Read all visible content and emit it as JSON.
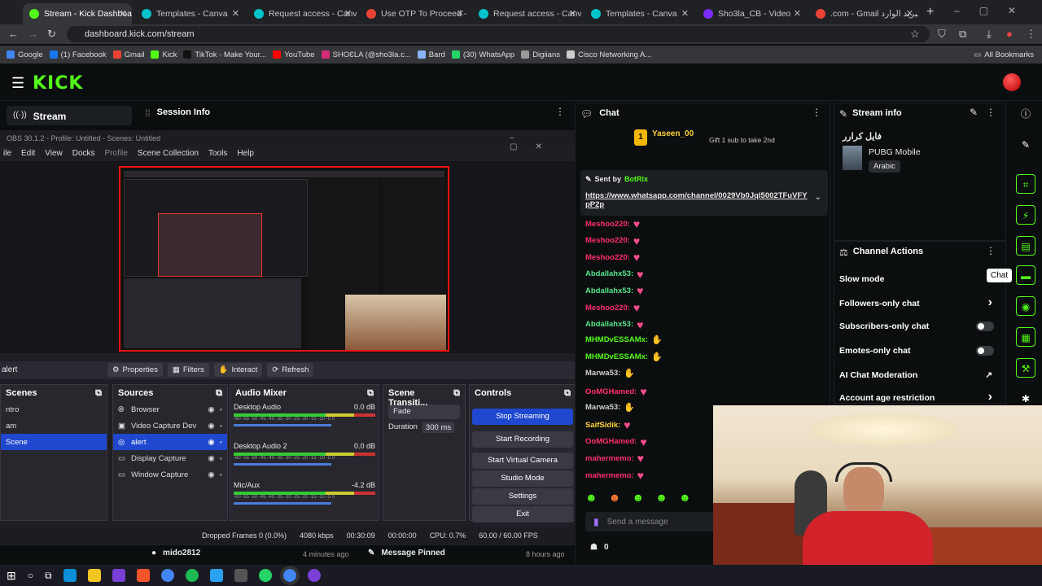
{
  "browser": {
    "tabs": [
      {
        "label": "Stream - Kick Dashboard",
        "active": true,
        "color": "#53fc18"
      },
      {
        "label": "Templates - Canva",
        "color": "#00c4cc"
      },
      {
        "label": "Request access - Canva",
        "color": "#00c4cc"
      },
      {
        "label": "Use OTP To Proceed - you",
        "color": "#ea4335"
      },
      {
        "label": "Request access - Canva",
        "color": "#00c4cc"
      },
      {
        "label": "Templates - Canva",
        "color": "#00c4cc"
      },
      {
        "label": "Sho3la_CB - Video",
        "color": "#7b2cff"
      },
      {
        "label": ".com - Gmail البريد الوارد",
        "color": "#ea4335"
      }
    ],
    "url": "dashboard.kick.com/stream",
    "bookmarks": [
      "Google",
      "(1) Facebook",
      "Gmail",
      "Kick",
      "TikTok - Make Your...",
      "YouTube",
      "SHOƐLA (@sho3la.c...",
      "Bard",
      "(30) WhatsApp",
      "Digiians",
      "Cisco Networking A..."
    ],
    "all_bookmarks": "All Bookmarks"
  },
  "kick": {
    "logo": "KICK",
    "sidebar_stream": "Stream",
    "session_info": "Session Info",
    "chat_title": "Chat",
    "stream_info_title": "Stream info",
    "gifter_name": "Yaseen_00",
    "gifter_count": "1",
    "gift_text": "Gift 1 sub to take 2nd",
    "pinned": {
      "sent_by": "Sent by",
      "sender": "BotRix",
      "link": "https://www.whatsapp.com/channel/0029Vb0Jql5002TFuVFYpP2p"
    },
    "messages": [
      {
        "user": "Meshoo220:",
        "color": "#ff2f6b",
        "emote": "heart"
      },
      {
        "user": "Meshoo220:",
        "color": "#ff2f6b",
        "emote": "heart"
      },
      {
        "user": "Meshoo220:",
        "color": "#ff2f6b",
        "emote": "heart"
      },
      {
        "user": "Abdallahx53:",
        "color": "#57e389",
        "emote": "heart"
      },
      {
        "user": "Abdallahx53:",
        "color": "#57e389",
        "emote": "heart"
      },
      {
        "user": "Meshoo220:",
        "color": "#ff2f6b",
        "emote": "heart"
      },
      {
        "user": "Abdallahx53:",
        "color": "#57e389",
        "emote": "heart"
      },
      {
        "user": "MHMDvESSAMx:",
        "color": "#53fc18",
        "emote": "hands"
      },
      {
        "user": "MHMDvESSAMx:",
        "color": "#53fc18",
        "emote": "hands"
      },
      {
        "user": "Marwa53:",
        "color": "#cfcfcf",
        "emote": "hands"
      },
      {
        "user": "OoMGHamed:",
        "color": "#ff2f6b",
        "emote": "heart"
      },
      {
        "user": "Marwa53:",
        "color": "#cfcfcf",
        "emote": "hands"
      },
      {
        "user": "SaifSidik:",
        "color": "#ffd33d",
        "emote": "heart"
      },
      {
        "user": "OoMGHamed:",
        "color": "#ff2f6b",
        "emote": "heart"
      },
      {
        "user": "mahermemo:",
        "color": "#ff2f6b",
        "emote": "heart"
      },
      {
        "user": "mahermemo:",
        "color": "#ff2f6b",
        "emote": "heart"
      }
    ],
    "send_placeholder": "Send a message",
    "chat_count": "0",
    "stream_title": "فايل كرارر",
    "game": "PUBG Mobile",
    "language": "Arabic",
    "channel_actions": "Channel Actions",
    "actions": [
      "Slow mode",
      "Followers-only chat",
      "Subscribers-only chat",
      "Emotes-only chat",
      "AI Chat Moderation",
      "Account age restriction"
    ],
    "tooltip": "Chat",
    "feed": [
      {
        "user": "mido2812",
        "time": "4 minutes ago"
      },
      {
        "user": "Message Pinned",
        "time": "8 hours ago"
      }
    ]
  },
  "obs": {
    "title": "OBS 30.1.2 - Profile: Untitled - Scenes: Untitled",
    "menu": [
      "ile",
      "Edit",
      "View",
      "Docks",
      "Profile",
      "Scene Collection",
      "Tools",
      "Help"
    ],
    "source_name": "alert",
    "toolbar": [
      "Properties",
      "Filters",
      "Interact",
      "Refresh"
    ],
    "scenes_title": "Scenes",
    "scenes": [
      "ntro",
      "am",
      "Scene"
    ],
    "sources_title": "Sources",
    "sources": [
      "Browser",
      "Video Capture Dev",
      "alert",
      "Display Capture",
      "Window Capture"
    ],
    "mixer_title": "Audio Mixer",
    "mixer": [
      {
        "name": "Desktop Audio",
        "db": "0.0 dB"
      },
      {
        "name": "Desktop Audio 2",
        "db": "0.0 dB"
      },
      {
        "name": "Mic/Aux",
        "db": "-4.2 dB"
      }
    ],
    "meter_ticks": "-60 -55 -50 -45 -40 -35 -30 -25 -20 -15 -10 -5 0",
    "transition_title": "Scene Transiti...",
    "transition": "Fade",
    "duration_label": "Duration",
    "duration": "300 ms",
    "controls_title": "Controls",
    "controls": [
      "Stop Streaming",
      "Start Recording",
      "Start Virtual Camera",
      "Studio Mode",
      "Settings",
      "Exit"
    ],
    "status": {
      "dropped": "Dropped Frames 0 (0.0%)",
      "kbps": "4080 kbps",
      "stream_time": "00:30:09",
      "rec_time": "00:00:00",
      "cpu": "CPU: 0.7%",
      "fps": "60.00 / 60.00 FPS"
    }
  }
}
